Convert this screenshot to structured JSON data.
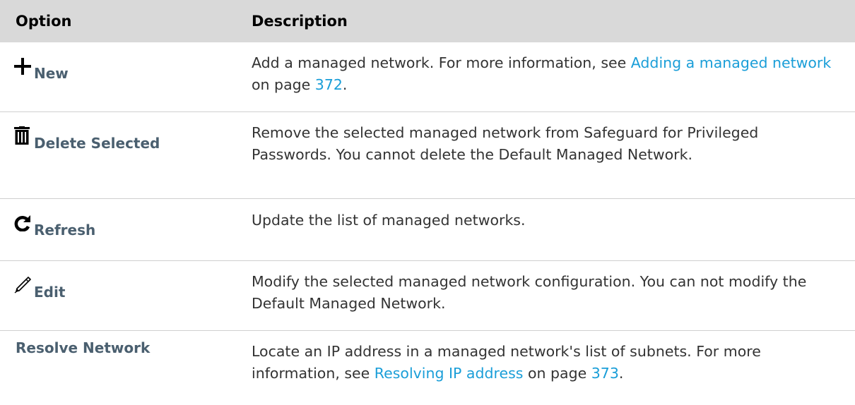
{
  "header": {
    "option": "Option",
    "description": "Description"
  },
  "rows": [
    {
      "option": "New",
      "icon": "plus-icon",
      "desc_before": "Add a managed network. For more information, see ",
      "link1": "Adding a managed network",
      "desc_mid": " on page ",
      "link2": "372",
      "desc_after": "."
    },
    {
      "option": "Delete Selected",
      "icon": "trash-icon",
      "desc": "Remove the selected managed network from Safeguard for Privileged Passwords. You cannot delete the Default Managed Network."
    },
    {
      "option": "Refresh",
      "icon": "refresh-icon",
      "desc": "Update the list of managed networks."
    },
    {
      "option": "Edit",
      "icon": "pencil-icon",
      "desc": "Modify the selected managed network configuration. You can not modify the Default Managed Network."
    },
    {
      "option": "Resolve Network",
      "desc_before": "Locate an IP address in a managed network's list of subnets. For more information, see ",
      "link1": "Resolving IP address",
      "desc_mid": " on page ",
      "link2": "373",
      "desc_after": "."
    }
  ],
  "colors": {
    "header_bg": "#d9d9d9",
    "option_text": "#4a5f6f",
    "link": "#1a9ed8",
    "body_text": "#333333"
  }
}
